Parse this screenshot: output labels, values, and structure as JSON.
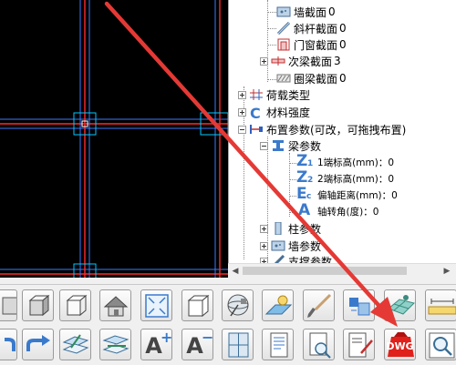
{
  "tree": {
    "items": [
      {
        "label": "墙截面",
        "count": "0",
        "icon": "wall-section-icon"
      },
      {
        "label": "斜杆截面",
        "count": "0",
        "icon": "brace-section-icon"
      },
      {
        "label": "门窗截面",
        "count": "0",
        "icon": "door-window-section-icon"
      },
      {
        "label": "次梁截面",
        "count": "3",
        "icon": "secondary-beam-section-icon"
      },
      {
        "label": "圈梁截面",
        "count": "0",
        "icon": "ring-beam-section-icon"
      },
      {
        "label": "荷载类型",
        "icon": "load-type-icon"
      },
      {
        "label": "材料强度",
        "icon": "material-strength-icon"
      },
      {
        "label": "布置参数(可改，可拖拽布置)",
        "icon": "layout-params-icon"
      },
      {
        "label": "梁参数",
        "icon": "beam-params-icon"
      },
      {
        "label": "1端标高(mm)：0",
        "icon": "z1-icon",
        "icon_text": "Z",
        "icon_sub": "1"
      },
      {
        "label": "2端标高(mm)：0",
        "icon": "z2-icon",
        "icon_text": "Z",
        "icon_sub": "2"
      },
      {
        "label": "偏轴距离(mm)：0",
        "icon": "ec-icon",
        "icon_text": "E",
        "icon_sub": "c"
      },
      {
        "label": "轴转角(度)：0",
        "icon": "axis-rotation-icon",
        "icon_text": "A"
      },
      {
        "label": "柱参数",
        "icon": "column-params-icon"
      },
      {
        "label": "墙参数",
        "icon": "wall-params-icon"
      },
      {
        "label": "支撑参数",
        "icon": "brace-params-icon"
      }
    ]
  },
  "toolbar": {
    "icons_row1": [
      "cube-front-icon",
      "cube-iso-icon",
      "cube-wire-icon",
      "house-icon",
      "zoom-extents-icon",
      "cube-outline-icon",
      "satellite-view-icon",
      "plane-render-icon",
      "brush-icon",
      "structure-blocks-icon",
      "tile-grid-icon",
      "measure-ruler-icon"
    ],
    "icons_row2": [
      "undo-icon",
      "redo-icon",
      "layer-edit-icon",
      "layer-switch-icon",
      "font-increase-icon",
      "font-decrease-icon",
      "window-grid-icon",
      "report-icon",
      "search-document-icon",
      "edit-document-icon",
      "dwg-export-icon",
      "preview-icon"
    ],
    "font_increase_label": "A",
    "font_increase_sign": "+",
    "font_decrease_label": "A",
    "font_decrease_sign": "−",
    "dwg_label": "DWG"
  },
  "colors": {
    "canvas_bg": "#000000",
    "grid_red": "#ff2a2a",
    "grid_blue": "#3a7cff",
    "node_cyan": "#00c8ff",
    "arrow_red": "#e53935",
    "dwg_red": "#e0201a"
  }
}
